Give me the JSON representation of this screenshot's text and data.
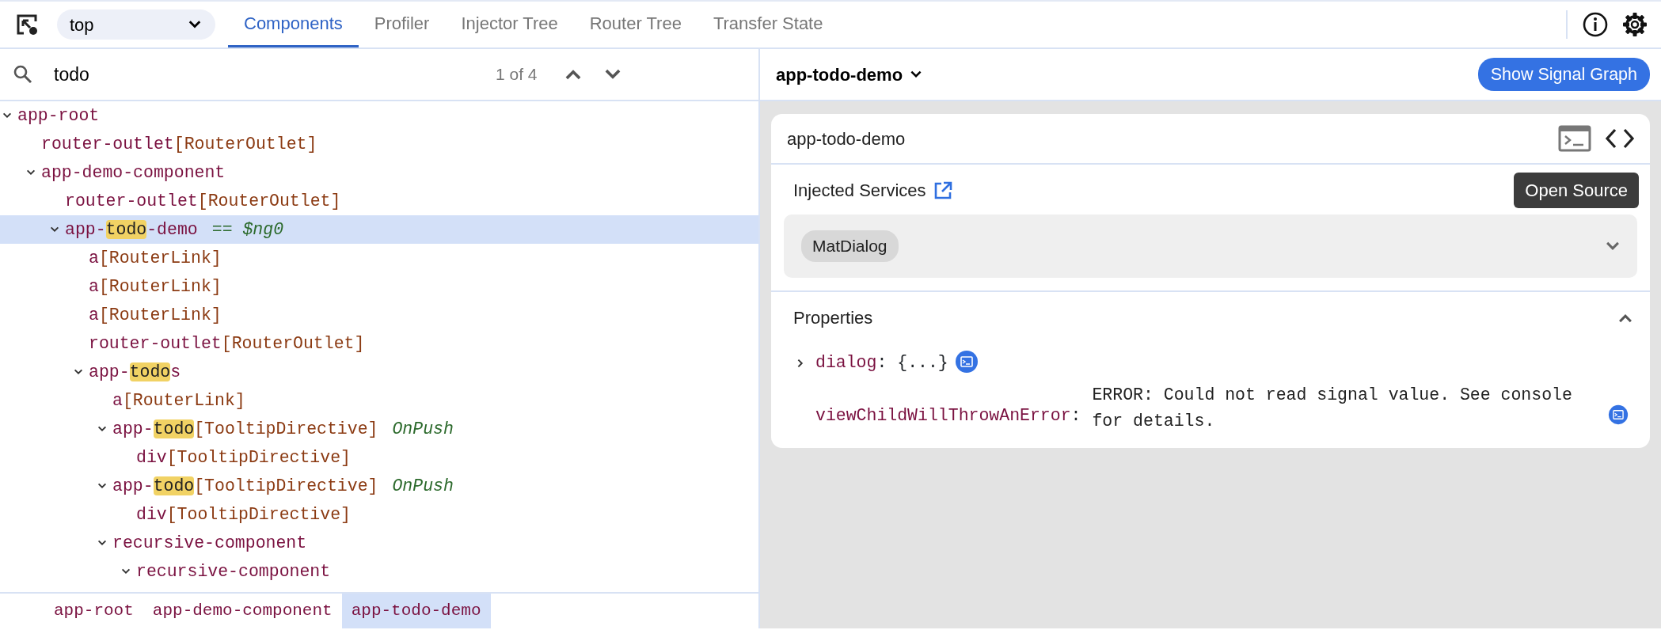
{
  "toolbar": {
    "frame_selector": {
      "value": "top"
    },
    "tabs": [
      {
        "label": "Components",
        "selected": true
      },
      {
        "label": "Profiler",
        "selected": false
      },
      {
        "label": "Injector Tree",
        "selected": false
      },
      {
        "label": "Router Tree",
        "selected": false
      },
      {
        "label": "Transfer State",
        "selected": false
      }
    ]
  },
  "search": {
    "value": "todo",
    "match_count": "1 of 4"
  },
  "tree": [
    {
      "name": [
        {
          "text": "app-root",
          "match": false
        }
      ],
      "expanded": true,
      "selected": false,
      "children": [
        {
          "name": [
            {
              "text": "router-outlet",
              "match": false
            }
          ],
          "directives": "[RouterOutlet]",
          "selected": false
        },
        {
          "name": [
            {
              "text": "app-demo-component",
              "match": false
            }
          ],
          "expanded": true,
          "selected": false,
          "children": [
            {
              "name": [
                {
                  "text": "router-outlet",
                  "match": false
                }
              ],
              "directives": "[RouterOutlet]",
              "selected": false
            },
            {
              "name": [
                {
                  "text": "app-",
                  "match": false
                },
                {
                  "text": "todo",
                  "match": true
                },
                {
                  "text": "-demo",
                  "match": false
                }
              ],
              "annotation": {
                "text": "== *$ng0*",
                "kind": "reference"
              },
              "expanded": true,
              "selected": true,
              "children": [
                {
                  "name": [
                    {
                      "text": "a",
                      "match": false
                    }
                  ],
                  "directives": "[RouterLink]",
                  "selected": false
                },
                {
                  "name": [
                    {
                      "text": "a",
                      "match": false
                    }
                  ],
                  "directives": "[RouterLink]",
                  "selected": false
                },
                {
                  "name": [
                    {
                      "text": "a",
                      "match": false
                    }
                  ],
                  "directives": "[RouterLink]",
                  "selected": false
                },
                {
                  "name": [
                    {
                      "text": "router-outlet",
                      "match": false
                    }
                  ],
                  "directives": "[RouterOutlet]",
                  "selected": false
                },
                {
                  "name": [
                    {
                      "text": "app-",
                      "match": false
                    },
                    {
                      "text": "todo",
                      "match": true
                    },
                    {
                      "text": "s",
                      "match": false
                    }
                  ],
                  "expanded": true,
                  "selected": false,
                  "children": [
                    {
                      "name": [
                        {
                          "text": "a",
                          "match": false
                        }
                      ],
                      "directives": "[RouterLink]",
                      "selected": false
                    },
                    {
                      "name": [
                        {
                          "text": "app-",
                          "match": false
                        },
                        {
                          "text": "todo",
                          "match": true
                        }
                      ],
                      "directives": "[TooltipDirective]",
                      "annotation": {
                        "text": "OnPush",
                        "kind": "strategy"
                      },
                      "expanded": true,
                      "selected": false,
                      "children": [
                        {
                          "name": [
                            {
                              "text": "div",
                              "match": false
                            }
                          ],
                          "directives": "[TooltipDirective]",
                          "selected": false
                        }
                      ]
                    },
                    {
                      "name": [
                        {
                          "text": "app-",
                          "match": false
                        },
                        {
                          "text": "todo",
                          "match": true
                        }
                      ],
                      "directives": "[TooltipDirective]",
                      "annotation": {
                        "text": "OnPush",
                        "kind": "strategy"
                      },
                      "expanded": true,
                      "selected": false,
                      "children": [
                        {
                          "name": [
                            {
                              "text": "div",
                              "match": false
                            }
                          ],
                          "directives": "[TooltipDirective]",
                          "selected": false
                        }
                      ]
                    },
                    {
                      "name": [
                        {
                          "text": "recursive-component",
                          "match": false
                        }
                      ],
                      "expanded": true,
                      "selected": false,
                      "children": [
                        {
                          "name": [
                            {
                              "text": "recursive-component",
                              "match": false
                            }
                          ],
                          "expanded": true,
                          "selected": false
                        }
                      ]
                    }
                  ]
                }
              ]
            }
          ]
        }
      ]
    }
  ],
  "breadcrumbs": [
    {
      "label": "app-root",
      "selected": false
    },
    {
      "label": "app-demo-component",
      "selected": false
    },
    {
      "label": "app-todo-demo",
      "selected": true
    }
  ],
  "details": {
    "header": {
      "title": "app-todo-demo"
    },
    "signal_graph_button": "Show Signal Graph",
    "card": {
      "title": "app-todo-demo",
      "tooltip": "Open Source",
      "injected_services": {
        "title": "Injected Services",
        "expanded": false,
        "services": [
          {
            "label": "MatDialog"
          }
        ]
      },
      "properties": {
        "title": "Properties",
        "expanded": true,
        "items": [
          {
            "key": "dialog",
            "separator": ":",
            "value": "{...}",
            "kind": "object",
            "expanded": false
          },
          {
            "key": "viewChildWillThrowAnError",
            "separator": ":",
            "value": "ERROR: Could not read signal value. See console for details.",
            "kind": "error"
          }
        ]
      }
    }
  }
}
